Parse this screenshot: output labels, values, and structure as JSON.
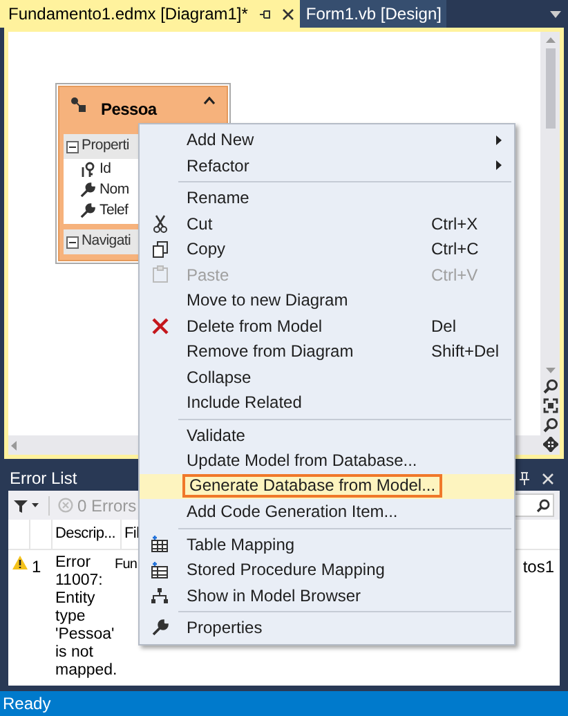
{
  "tabs": [
    {
      "label": "Fundamento1.edmx [Diagram1]*",
      "selected": true
    },
    {
      "label": "Form1.vb [Design]",
      "selected": false
    }
  ],
  "entity": {
    "name": "Pessoa",
    "sections": [
      {
        "label": "Properti",
        "expanded": true,
        "children": [
          {
            "label": "Id",
            "kind": "key"
          },
          {
            "label": "Nom",
            "kind": "property"
          },
          {
            "label": "Telef",
            "kind": "property"
          }
        ]
      },
      {
        "label": "Navigati",
        "expanded": true
      }
    ]
  },
  "context_menu": [
    {
      "kind": "item",
      "label": "Add New",
      "submenu": true,
      "disabled": false,
      "selected": false
    },
    {
      "kind": "item",
      "label": "Refactor",
      "submenu": true,
      "disabled": false,
      "selected": false
    },
    {
      "kind": "separator"
    },
    {
      "kind": "item",
      "label": "Rename",
      "submenu": false,
      "disabled": false,
      "selected": false
    },
    {
      "kind": "item",
      "label": "Cut",
      "shortcut": "Ctrl+X",
      "submenu": false,
      "disabled": false,
      "selected": false
    },
    {
      "kind": "item",
      "label": "Copy",
      "shortcut": "Ctrl+C",
      "submenu": false,
      "disabled": false,
      "selected": false
    },
    {
      "kind": "item",
      "label": "Paste",
      "shortcut": "Ctrl+V",
      "submenu": false,
      "disabled": true,
      "selected": false
    },
    {
      "kind": "item",
      "label": "Move to new Diagram",
      "submenu": false,
      "disabled": false,
      "selected": false
    },
    {
      "kind": "item",
      "label": "Delete from Model",
      "shortcut": "Del",
      "submenu": false,
      "disabled": false,
      "selected": false
    },
    {
      "kind": "item",
      "label": "Remove from Diagram",
      "shortcut": "Shift+Del",
      "submenu": false,
      "disabled": false,
      "selected": false
    },
    {
      "kind": "item",
      "label": "Collapse",
      "submenu": false,
      "disabled": false,
      "selected": false
    },
    {
      "kind": "item",
      "label": "Include Related",
      "submenu": false,
      "disabled": false,
      "selected": false
    },
    {
      "kind": "separator"
    },
    {
      "kind": "item",
      "label": "Validate",
      "submenu": false,
      "disabled": false,
      "selected": false
    },
    {
      "kind": "item",
      "label": "Update Model from Database...",
      "submenu": false,
      "disabled": false,
      "selected": false
    },
    {
      "kind": "item",
      "label": "Generate Database from Model...",
      "submenu": false,
      "disabled": false,
      "selected": true
    },
    {
      "kind": "item",
      "label": "Add Code Generation Item...",
      "submenu": false,
      "disabled": false,
      "selected": false
    },
    {
      "kind": "separator"
    },
    {
      "kind": "item",
      "label": "Table Mapping",
      "submenu": false,
      "disabled": false,
      "selected": false
    },
    {
      "kind": "item",
      "label": "Stored Procedure Mapping",
      "submenu": false,
      "disabled": false,
      "selected": false
    },
    {
      "kind": "item",
      "label": "Show in Model Browser",
      "submenu": false,
      "disabled": false,
      "selected": false
    },
    {
      "kind": "separator"
    },
    {
      "kind": "item",
      "label": "Properties",
      "submenu": false,
      "disabled": false,
      "selected": false
    }
  ],
  "error_list": {
    "title": "Error List",
    "errors_filter": "0 Errors",
    "columns": [
      "Descrip...",
      "Fil"
    ],
    "rows": [
      {
        "index": "1",
        "description": "Error 11007: Entity type 'Pessoa' is not mapped.",
        "file": "Fun",
        "column_5": "tos1"
      }
    ]
  },
  "status_bar": "Ready"
}
